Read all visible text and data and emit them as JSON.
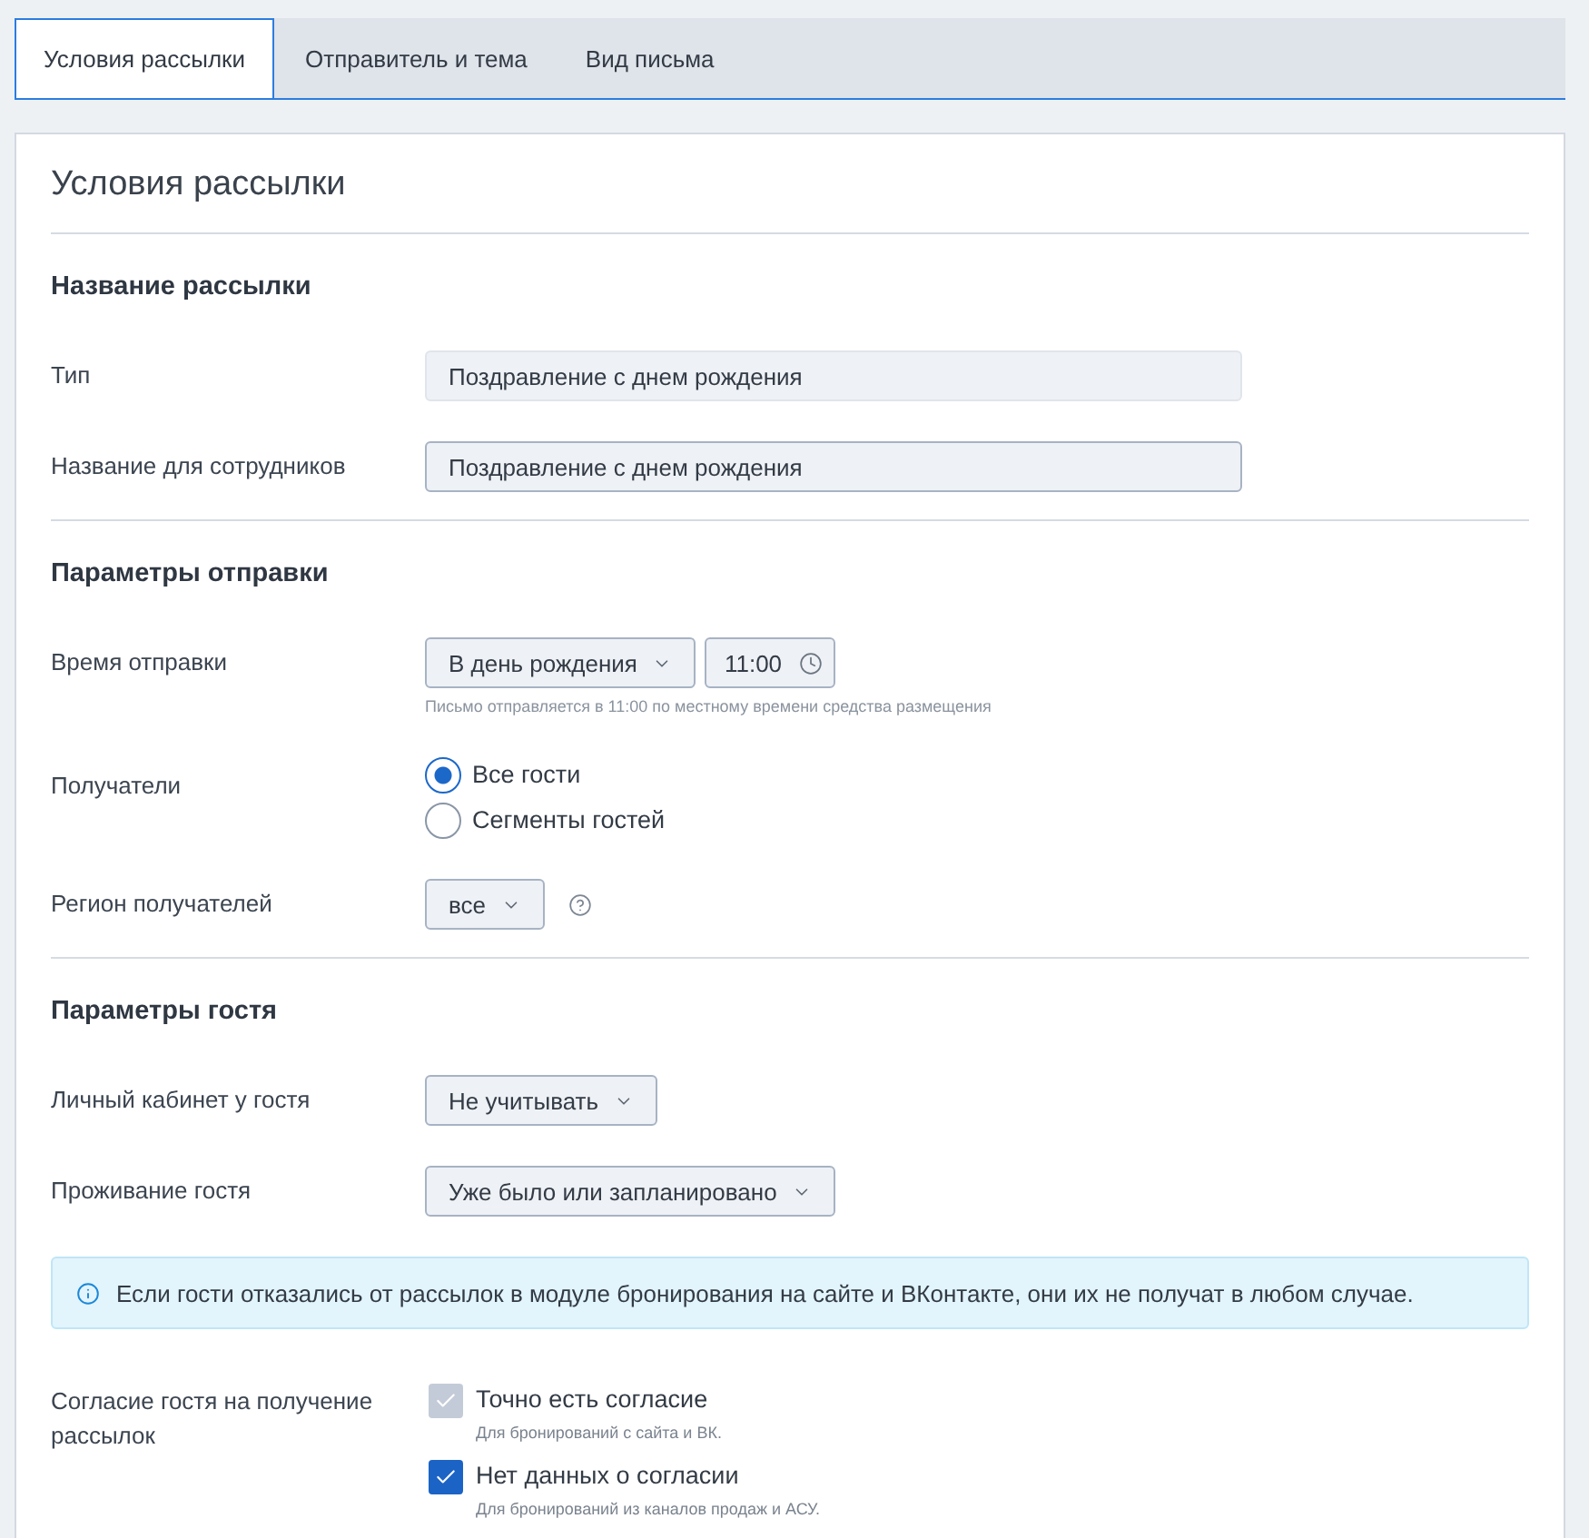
{
  "tabs": [
    {
      "label": "Условия рассылки",
      "selected": true
    },
    {
      "label": "Отправитель и тема",
      "selected": false
    },
    {
      "label": "Вид письма",
      "selected": false
    }
  ],
  "card": {
    "title": "Условия рассылки",
    "sections": [
      {
        "heading": "Название рассылки",
        "rows": [
          {
            "kind": "text",
            "label": "Тип",
            "value": "Поздравление с днем рождения",
            "disabled": true
          },
          {
            "kind": "text",
            "label": "Название для сотрудников",
            "value": "Поздравление с днем рождения",
            "disabled": false
          }
        ]
      },
      {
        "heading": "Параметры отправки",
        "rows": [
          {
            "kind": "schedule",
            "label": "Время отправки",
            "select": "В день рождения",
            "time": "11:00",
            "hint": "Письмо отправляется в 11:00 по местному времени средства размещения"
          },
          {
            "kind": "radio",
            "label": "Получатели",
            "options": [
              {
                "label": "Все гости",
                "selected": true
              },
              {
                "label": "Сегменты гостей",
                "selected": false
              }
            ]
          },
          {
            "kind": "select",
            "label": "Регион получателей",
            "value": "все",
            "help": true
          }
        ]
      },
      {
        "heading": "Параметры гостя",
        "rows": [
          {
            "kind": "select",
            "label": "Личный кабинет у гостя",
            "value": "Не учитывать"
          },
          {
            "kind": "select",
            "label": "Проживание гостя",
            "value": "Уже было или запланировано"
          },
          {
            "kind": "notice",
            "text": "Если гости отказались от рассылок в модуле бронирования на сайте и ВКонтакте, они их не получат в любом случае."
          },
          {
            "kind": "checkbox",
            "label": "Согласие гостя на получение рассылок",
            "options": [
              {
                "label": "Точно есть согласие",
                "note": "Для бронирований с сайта и ВК.",
                "checked": true,
                "disabled": true
              },
              {
                "label": "Нет данных о согласии",
                "note": "Для бронирований из каналов продаж и АСУ.",
                "checked": true,
                "disabled": false
              }
            ]
          }
        ]
      }
    ]
  }
}
